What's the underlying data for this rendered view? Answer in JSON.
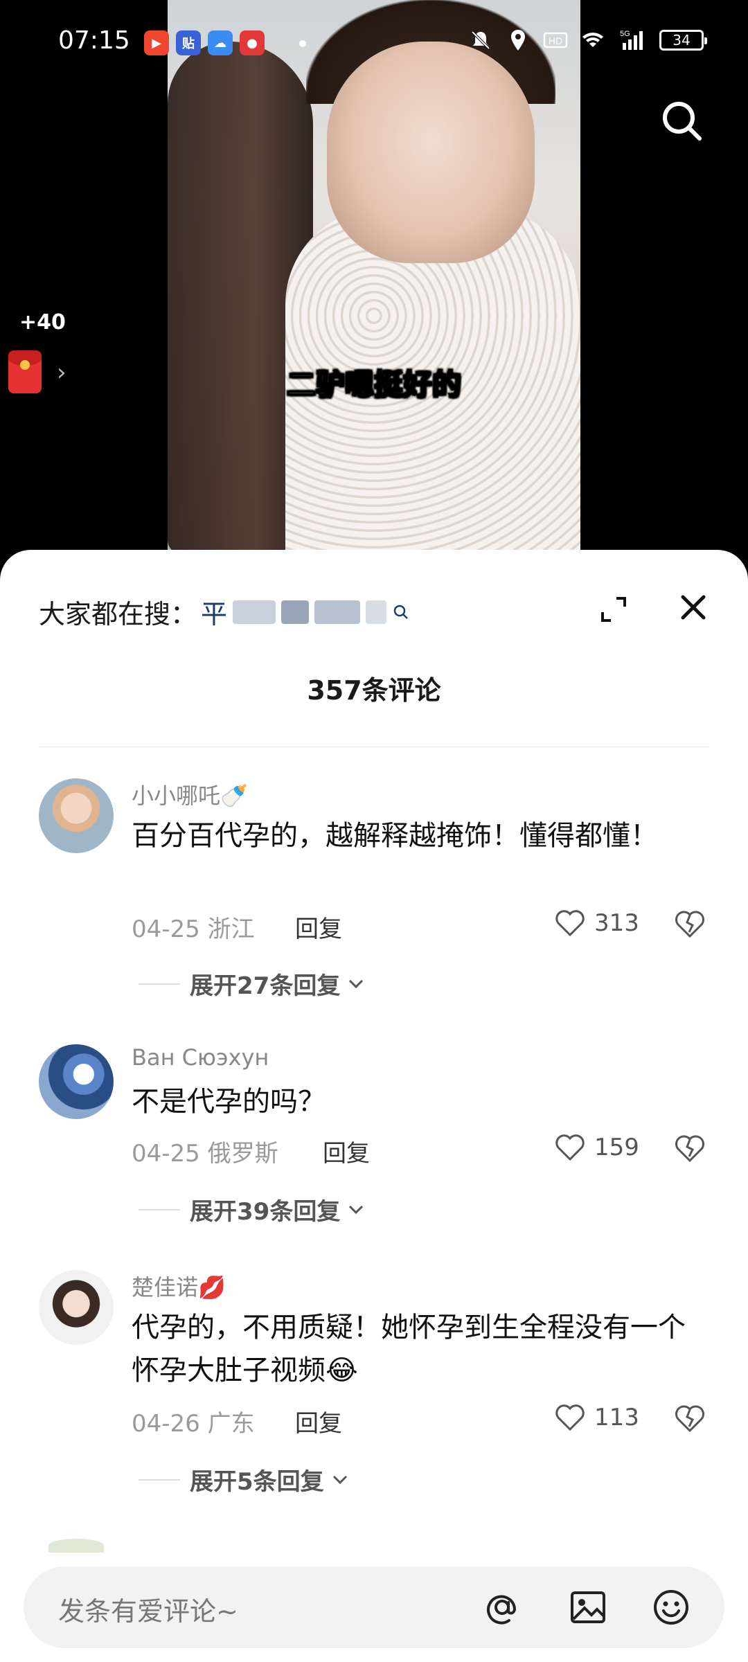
{
  "status_bar": {
    "time": "07:15",
    "battery": "34",
    "network": "5G"
  },
  "video": {
    "subtitle": "二驴嗯挺好的"
  },
  "reward": {
    "points": "+40"
  },
  "sheet": {
    "hot_search_label": "大家都在搜：",
    "hot_search_term": "平",
    "comment_count": "357条评论"
  },
  "comments": [
    {
      "user": "小小哪吒🍼",
      "text": "百分百代孕的，越解释越掩饰！懂得都懂！",
      "date": "04-25",
      "region": "浙江",
      "reply_label": "回复",
      "likes": "313",
      "expand": "展开27条回复"
    },
    {
      "user": "Ван Сюэхун",
      "text": "不是代孕的吗？",
      "date": "04-25",
      "region": "俄罗斯",
      "reply_label": "回复",
      "likes": "159",
      "expand": "展开39条回复"
    },
    {
      "user": "楚佳诺💋",
      "text": "代孕的，不用质疑！她怀孕到生全程没有一个怀孕大肚子视频😂",
      "date": "04-26",
      "region": "广东",
      "reply_label": "回复",
      "likes": "113",
      "expand": "展开5条回复"
    }
  ],
  "input": {
    "placeholder": "发条有爱评论~"
  },
  "icons": {
    "search": "search-icon",
    "expand": "expand-icon",
    "close": "close-icon",
    "like": "heart-icon",
    "dislike": "broken-heart-icon",
    "mention": "at-icon",
    "image": "image-icon",
    "emoji": "emoji-icon"
  }
}
